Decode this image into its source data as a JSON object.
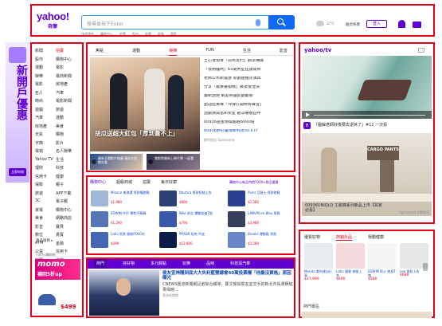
{
  "header": {
    "logo": "yahoo!",
    "logo_sub": "奇摩",
    "search_placeholder": "搜尋並按下Enter",
    "quick_links": [
      "快速連結",
      "購物中心",
      "拍賣",
      "股市",
      "新聞",
      "氣象",
      "電影"
    ],
    "weather": "27°C",
    "small_links": "雅虎奇摩",
    "login_label": "登入"
  },
  "left_ad": {
    "title": "新開戶優惠",
    "button": "立即申辦"
  },
  "sidebar": {
    "items": [
      [
        "新聞",
        "拍賣"
      ],
      [
        "股市",
        "購物中心"
      ],
      [
        "運動",
        "電影"
      ],
      [
        "娛樂",
        "電商新聞"
      ],
      [
        "電影",
        "房地產"
      ],
      [
        "名人",
        "汽車"
      ],
      [
        "時尚",
        "電影新聞"
      ],
      [
        "遊戲",
        "旅遊"
      ],
      [
        "汽車",
        "運動"
      ],
      [
        "房地產",
        "美食"
      ],
      [
        "天氣",
        "購物"
      ],
      [
        "字典",
        "影片"
      ],
      [
        "電視",
        "名人娛樂"
      ],
      [
        "Yahoo TV",
        "生活"
      ],
      [
        "理財",
        "科技"
      ],
      [
        "信用卡",
        "健康"
      ],
      [
        "保險",
        "親子"
      ],
      [
        "旅遊",
        "APP下載"
      ],
      [
        "3C",
        "電子報"
      ],
      [
        "家電",
        "購物中心"
      ],
      [
        "美食",
        "網路商店"
      ],
      [
        "影音",
        "寶貝"
      ],
      [
        "數位",
        "貴賓"
      ],
      [
        "ATM",
        "金融"
      ],
      [
        "公益",
        "信用卡"
      ],
      [
        "家居",
        "遊戲"
      ],
      [
        "美妝",
        "問答"
      ]
    ],
    "more": "更多服務 ▸",
    "momo_label": "momo購物網",
    "momo_title": "momo",
    "momo_sub": "補回5折up",
    "momo_price": "$499"
  },
  "news": {
    "tabs": [
      "焦點",
      "運動",
      "娛樂",
      "FUN",
      "生活",
      "影音"
    ],
    "active_tab": "娛樂",
    "main_caption": "胡瓜送超大紅包「厚到蓋不上」",
    "thumbs": [
      "最新主題影片推薦 精彩片段搶先看",
      "電影院最新上映片單 一起看"
    ],
    "headlines": [
      "王心凌現身「前男友們」觀眾嗨爆",
      "「很用腦啊」63歲男星狂讚成熟",
      "老師公布新進度 原劇團確定演出",
      "分享「最貴蘿蔔糕」挨批後澄清",
      "最新話題 網友熱議影劇動態",
      "劉冠廷驚曝「沖澡打開時有聲音」",
      "話劇演員當AI女星 觀眾嚇傻直呼",
      "00936基金規模超越6000億",
      "00936野村臺灣新科技50 ETF"
    ],
    "sponsor": "野村投信",
    "sponsored_label": "Sponsored"
  },
  "shop": {
    "tabs": [
      "購物中心",
      "超級商城",
      "拍賣",
      "每日好康"
    ],
    "active_tab": "購物中心",
    "promo": "購物中心新品特價7000+商品優惠",
    "items": [
      {
        "name": "Mizuno 美津濃 男款慢跑鞋",
        "price": "$1,980"
      },
      {
        "name": "Nautica 男款短袖上衣",
        "price": "$890"
      },
      {
        "name": "Asics 亞瑟士 男款跑鞋",
        "price": "$2,380"
      },
      {
        "name": "EDWIN 牛仔 彈性丹寧褲",
        "price": "$1,290"
      },
      {
        "name": "Nike 耐吉 運動短袖T恤",
        "price": "$790"
      },
      {
        "name": "LANVIN en Bleu 男鞋",
        "price": "$3,980"
      },
      {
        "name": "Lativ 男款 條紋POLO衫",
        "price": "$299"
      },
      {
        "name": "PRADA 短夾 牛皮",
        "price": "$12,800"
      },
      {
        "name": "Brooks 運動鞋 男款",
        "price": "$3,280"
      }
    ]
  },
  "bottom_news": {
    "tabs": [
      "熱門",
      "夯好物",
      "多元觀點",
      "玩樂",
      "品味",
      "科技與汽車"
    ],
    "headline": "侯友宜神隱到底大大失利藍營總會40萬投票權「他最沒資格」原因曝光",
    "desc": "CNEWS匯流新聞網記者綜合報導，鄭文燦與侯友宜交手的新北市長選舉結果揭曉...",
    "source": "匯流新聞網"
  },
  "video": {
    "logo": "yahoo/tv",
    "title": "「圖解老師好像要去退休了」#12 一次看",
    "ad_caption": "CARGO PANTS",
    "ad_text": "00936UNIQLO 工裝褲系列新品上市【買家必看】",
    "sponsor": "Sponsored UNIQLO"
  },
  "products": {
    "tabs": [
      "優質好物",
      "熱銷外品",
      "我動健康"
    ],
    "active_tab": "熱銷外品",
    "items": [
      {
        "name": "Merida 美利達自行車",
        "price": "$17,999"
      },
      {
        "name": "Lativ 優質 休閒上衣",
        "price": "$690"
      },
      {
        "name": "EDWIN 男士 修身T恤",
        "price": "$580"
      },
      {
        "name": "Lee 男款上衣",
        "price": "$680"
      }
    ],
    "section": "熱門專區"
  },
  "colors": {
    "accent": "#6001d2",
    "highlight": "#e4001b",
    "link": "#0f47c0"
  }
}
